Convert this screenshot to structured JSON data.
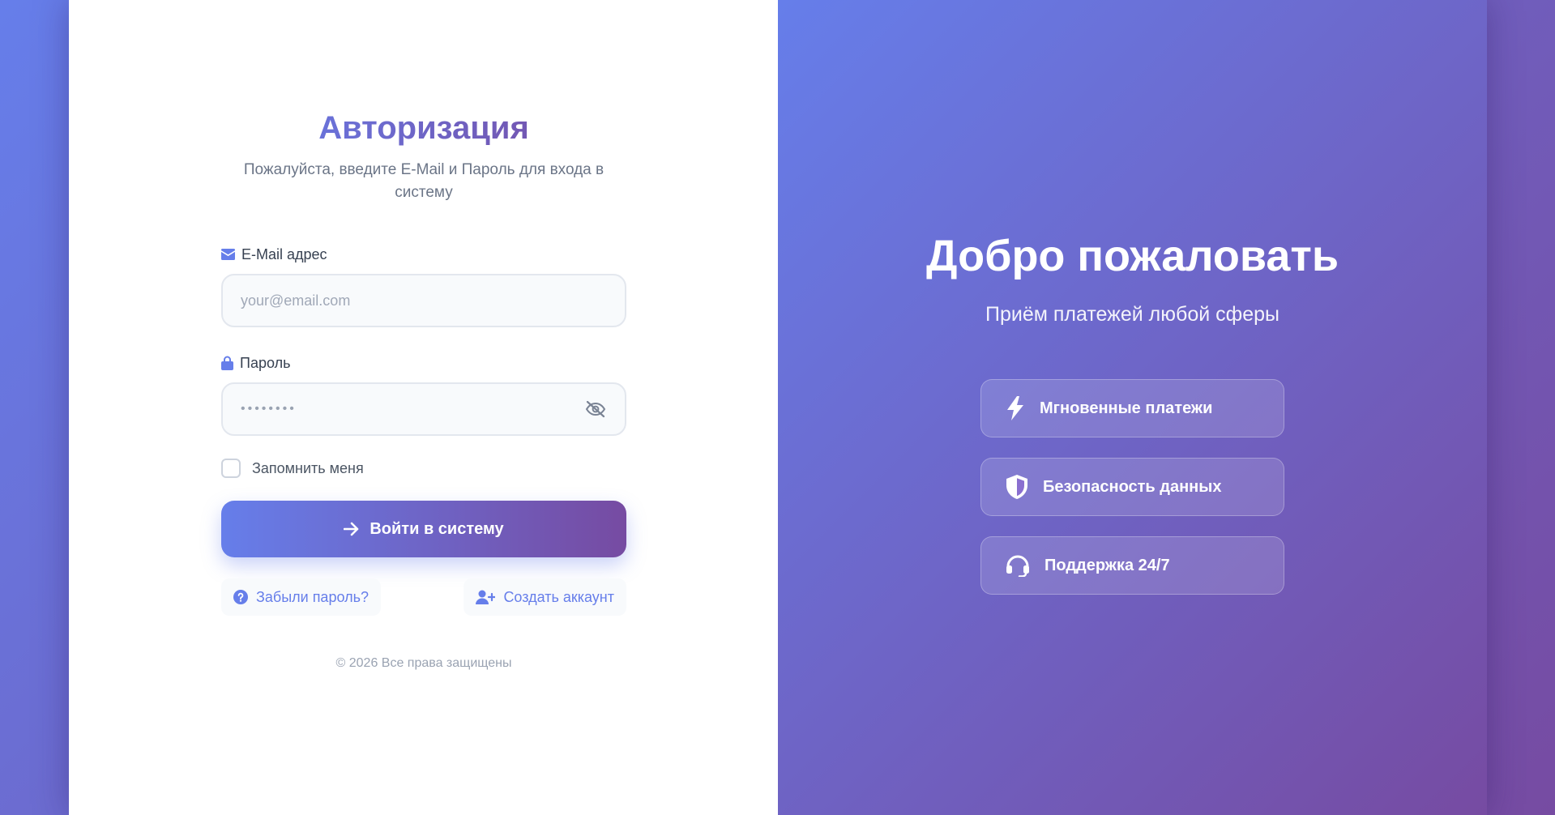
{
  "login": {
    "title": "Авторизация",
    "subtitle": "Пожалуйста, введите E-Mail и Пароль для входа в систему",
    "email_label": "E-Mail адрес",
    "email_placeholder": "your@email.com",
    "password_label": "Пароль",
    "password_value": "••••••••",
    "remember_label": "Запомнить меня",
    "remember_checked": false,
    "submit_label": "Войти в систему",
    "forgot_label": "Забыли пароль?",
    "create_label": "Создать аккаунт",
    "copyright": "© 2026 Все права защищены"
  },
  "welcome": {
    "title": "Добро пожаловать",
    "tagline": "Приём платежей любой сферы",
    "features": [
      {
        "label": "Мгновенные платежи",
        "icon": "bolt-icon"
      },
      {
        "label": "Безопасность данных",
        "icon": "shield-icon"
      },
      {
        "label": "Поддержка 24/7",
        "icon": "headset-icon"
      }
    ]
  },
  "colors": {
    "accent_start": "#667eea",
    "accent_end": "#764ba2"
  }
}
